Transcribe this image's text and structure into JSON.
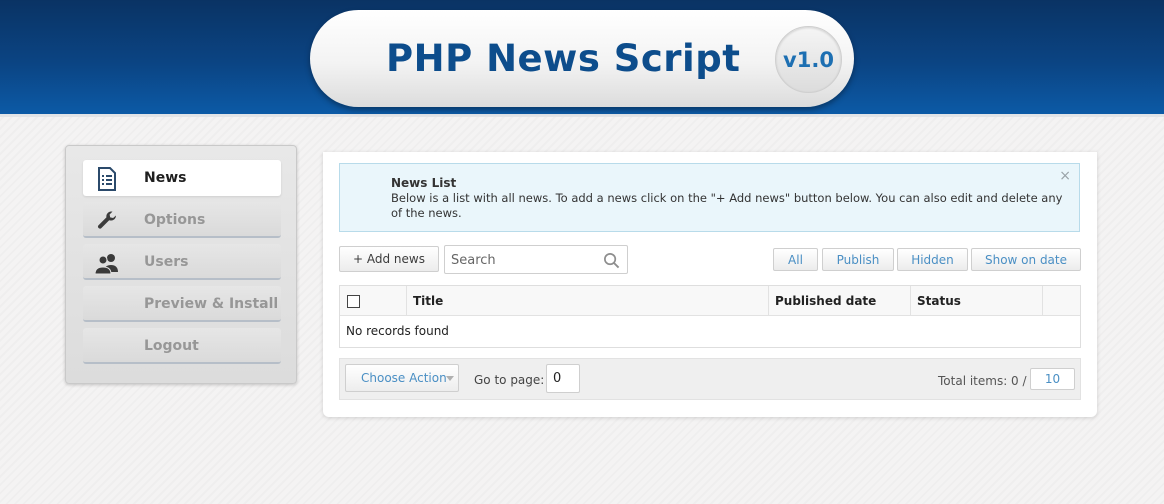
{
  "header": {
    "title": "PHP News Script",
    "version": "v1.0"
  },
  "sidebar": {
    "items": [
      {
        "label": "News",
        "icon": "document-list-icon",
        "active": true
      },
      {
        "label": "Options",
        "icon": "wrench-icon",
        "active": false
      },
      {
        "label": "Users",
        "icon": "users-icon",
        "active": false
      },
      {
        "label": "Preview & Install",
        "icon": "",
        "active": false
      },
      {
        "label": "Logout",
        "icon": "",
        "active": false
      }
    ]
  },
  "info": {
    "title": "News List",
    "text": "Below is a list with all news. To add a news click on the \"+ Add news\" button below. You can also edit and delete any of the news.",
    "close": "×"
  },
  "toolbar": {
    "add_label": "+ Add news",
    "search_placeholder": "Search",
    "filters": [
      "All",
      "Publish",
      "Hidden",
      "Show on date"
    ]
  },
  "table": {
    "columns": [
      "",
      "Title",
      "Published date",
      "Status",
      ""
    ],
    "empty_message": "No records found"
  },
  "footer": {
    "action_label": "Choose Action",
    "goto_label": "Go to page:",
    "goto_value": "0",
    "total_label": "Total items: 0 /",
    "per_page": "10"
  },
  "colors": {
    "header_blue": "#0b4483",
    "title_blue": "#0d4d8c",
    "link_blue": "#4a8fc4",
    "info_bg": "#eaf6fb"
  }
}
